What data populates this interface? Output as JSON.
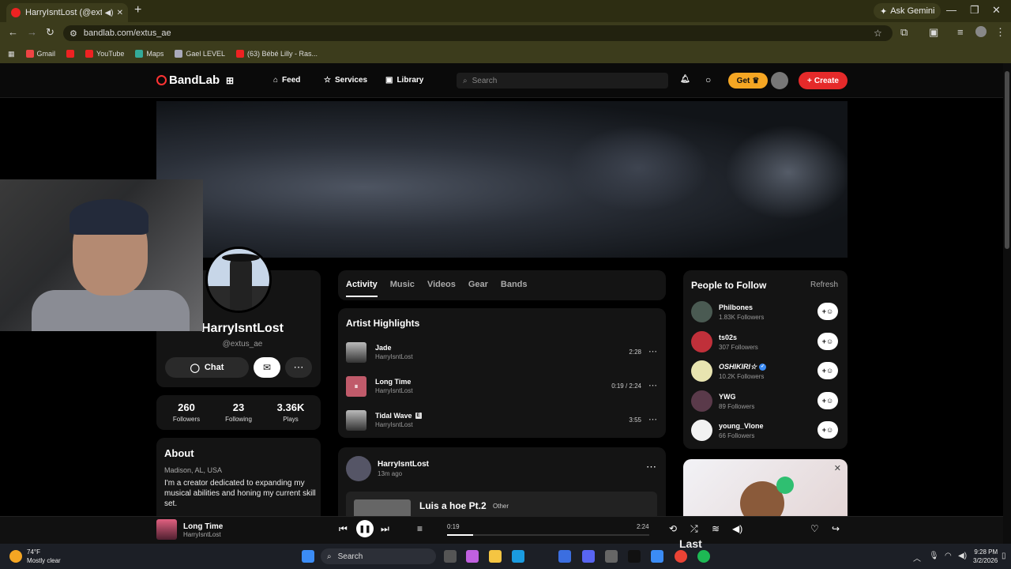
{
  "browser": {
    "tab_title": "HarryIsntLost (@extus_ae) -",
    "new_tab": "+",
    "ask_gemini": "Ask Gemini",
    "url": "bandlab.com/extus_ae",
    "bookmarks": [
      "Gmail",
      "YouTube",
      "Maps",
      "Gael LEVEL",
      "(63) Bébé Lilly - Ras..."
    ]
  },
  "nav": {
    "logo": "BandLab",
    "feed": "Feed",
    "services": "Services",
    "library": "Library",
    "search_placeholder": "Search",
    "get": "Get",
    "create": "Create"
  },
  "profile": {
    "name": "HarryIsntLost",
    "handle": "@extus_ae",
    "chat": "Chat",
    "stats": [
      {
        "value": "260",
        "label": "Followers"
      },
      {
        "value": "23",
        "label": "Following"
      },
      {
        "value": "3.36K",
        "label": "Plays"
      }
    ],
    "about_title": "About",
    "location": "Madison, AL, USA",
    "bio": "I'm a creator dedicated to expanding my musical abilities and honing my current skill set."
  },
  "tabs": [
    "Activity",
    "Music",
    "Videos",
    "Gear",
    "Bands"
  ],
  "highlights": {
    "title": "Artist Highlights",
    "tracks": [
      {
        "title": "Jade",
        "artist": "HarryIsntLost",
        "duration": "2:28"
      },
      {
        "title": "Long Time",
        "artist": "HarryIsntLost",
        "duration": "0:19 / 2:24"
      },
      {
        "title": "Tidal Wave",
        "artist": "HarryIsntLost",
        "duration": "3:55",
        "badge": "E"
      }
    ]
  },
  "post": {
    "author": "HarryIsntLost",
    "time": "13m ago",
    "song": "Luis a hoe Pt.2",
    "genre": "Other"
  },
  "people": {
    "title": "People to Follow",
    "refresh": "Refresh",
    "follow_label": "+",
    "list": [
      {
        "name": "Philbones",
        "followers": "1.83K Followers",
        "color": "#4a5a52"
      },
      {
        "name": "ts02s",
        "followers": "307 Followers",
        "color": "#c0303a"
      },
      {
        "name": "OSHIKIRI☆",
        "followers": "10.2K Followers",
        "color": "#e8e4b0",
        "verified": true
      },
      {
        "name": "YWG",
        "followers": "89 Followers",
        "color": "#5a3a4a"
      },
      {
        "name": "young_Vlone",
        "followers": "66 Followers",
        "color": "#f2f2f2"
      }
    ]
  },
  "player": {
    "title": "Long Time",
    "artist": "HarryIsntLost",
    "current": "0:19",
    "total": "2:24",
    "progress": 0.13
  },
  "taskbar": {
    "temp": "74°F",
    "condition": "Mostly clear",
    "search": "Search",
    "overlay_text": "Last",
    "time": "9:28 PM",
    "date": "3/2/2026"
  }
}
